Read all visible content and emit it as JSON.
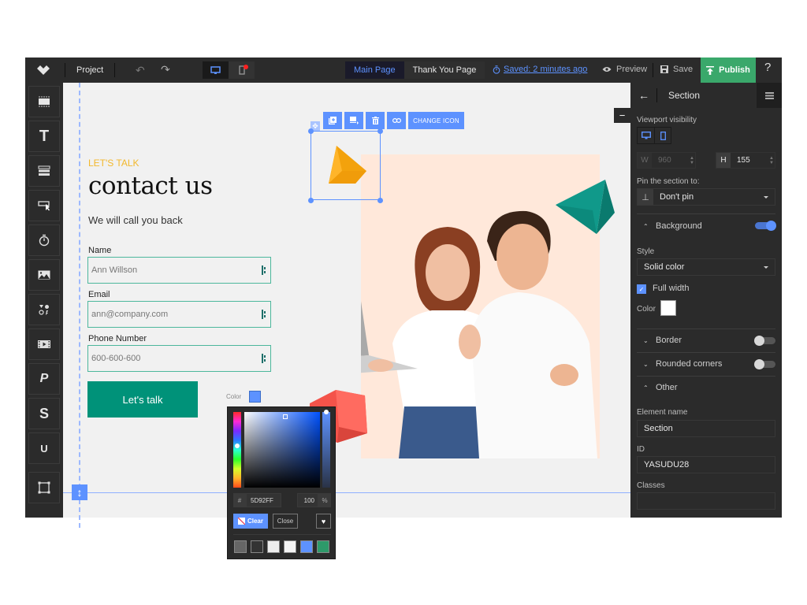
{
  "topbar": {
    "project_label": "Project",
    "pages": [
      {
        "label": "Main Page",
        "active": true
      },
      {
        "label": "Thank You Page",
        "active": false
      }
    ],
    "saved_status": "Saved: 2 minutes ago",
    "preview_label": "Preview",
    "save_label": "Save",
    "publish_label": "Publish",
    "help_label": "?",
    "undo_icon": "↶",
    "redo_icon": "↷"
  },
  "left_sidebar": {
    "tools": [
      {
        "name": "section",
        "icon": "section-icon"
      },
      {
        "name": "text",
        "icon": "text-icon",
        "glyph": "T"
      },
      {
        "name": "form",
        "icon": "form-icon"
      },
      {
        "name": "button",
        "icon": "button-icon"
      },
      {
        "name": "timer",
        "icon": "timer-icon",
        "glyph": "⏱"
      },
      {
        "name": "image",
        "icon": "image-icon"
      },
      {
        "name": "icons",
        "icon": "icons-icon"
      },
      {
        "name": "video",
        "icon": "video-icon"
      },
      {
        "name": "paypal",
        "icon": "paypal-icon",
        "glyph": "P"
      },
      {
        "name": "stripe",
        "icon": "stripe-icon",
        "glyph": "S"
      },
      {
        "name": "magnet",
        "icon": "magnet-icon",
        "glyph": "U"
      },
      {
        "name": "shape",
        "icon": "shape-icon"
      }
    ]
  },
  "canvas": {
    "eyebrow": "LET'S TALK",
    "heading": "contact us",
    "subheading": "We will call you back",
    "fields": [
      {
        "label": "Name",
        "placeholder": "Ann Willson"
      },
      {
        "label": "Email",
        "placeholder": "ann@company.com"
      },
      {
        "label": "Phone Number",
        "placeholder": "600-600-600"
      }
    ],
    "cta_label": "Let's talk",
    "icon_toolbar": {
      "change_icon_label": "CHANGE ICON",
      "buttons": [
        "duplicate-icon",
        "layer-icon",
        "trash-icon",
        "link-icon"
      ]
    },
    "color_label": "Color",
    "selected_color": "#5d92ff"
  },
  "color_picker": {
    "hex_prefix": "#",
    "hex_value": "5D92FF",
    "alpha_value": "100",
    "alpha_unit": "%",
    "clear_label": "Clear",
    "close_label": "Close",
    "presets": [
      "#666666",
      "#333333",
      "#eeeeee",
      "#f4f4f4",
      "#5d92ff",
      "#2e9a6a"
    ]
  },
  "right_panel": {
    "title": "Section",
    "viewport_label": "Viewport visibility",
    "width_key": "W",
    "width_value": "960",
    "height_key": "H",
    "height_value": "155",
    "pin_label": "Pin the section to:",
    "pin_value": "Don't pin",
    "background_label": "Background",
    "background_on": true,
    "style_label": "Style",
    "style_value": "Solid color",
    "full_width_label": "Full width",
    "full_width_checked": true,
    "color_label": "Color",
    "bg_color": "#ffffff",
    "border_label": "Border",
    "border_on": false,
    "rounded_label": "Rounded corners",
    "rounded_on": false,
    "other_label": "Other",
    "element_name_label": "Element name",
    "element_name_value": "Section",
    "id_label": "ID",
    "id_value": "YASUDU28",
    "classes_label": "Classes",
    "classes_value": ""
  },
  "colors": {
    "accent": "#5d92ff",
    "publish": "#3aa86b",
    "cta": "#009279",
    "eyebrow": "#f2b82d"
  }
}
